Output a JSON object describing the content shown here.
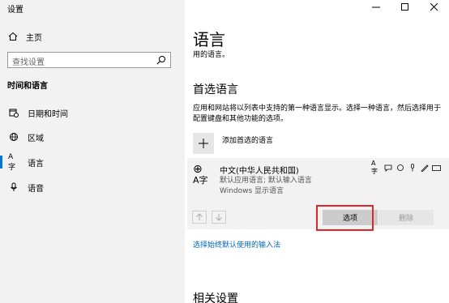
{
  "app": {
    "title": "设置"
  },
  "nav": {
    "home_label": "主页",
    "search_placeholder": "查找设置",
    "section_label": "时间和语言",
    "items": [
      {
        "label": "日期和时间",
        "icon": "calendar-clock-icon"
      },
      {
        "label": "区域",
        "icon": "globe-icon"
      },
      {
        "label": "语言",
        "icon": "language-icon",
        "active": true
      },
      {
        "label": "语音",
        "icon": "microphone-icon"
      }
    ]
  },
  "main": {
    "title": "语言",
    "subtitle": "用的语言。",
    "preferred_heading": "首选语言",
    "description": "应用和网站将以列表中支持的第一种语言显示。选择一种语言，然后选择用于配置键盘和其他功能的选项。",
    "add_language_label": "添加首选的语言",
    "language": {
      "icon_glyph_top": "⊕",
      "icon_glyph_bottom": "A字",
      "name": "中文(中华人民共和国)",
      "detail1": "默认应用语言; 默认输入语言",
      "detail2": "Windows 显示语言",
      "options_button": "选项",
      "remove_button": "删除"
    },
    "link_text": "选择始终默认使用的输入法",
    "related_heading": "相关设置"
  },
  "colors": {
    "accent": "#0078d7",
    "link": "#0067b8",
    "highlight": "#e0262b"
  }
}
